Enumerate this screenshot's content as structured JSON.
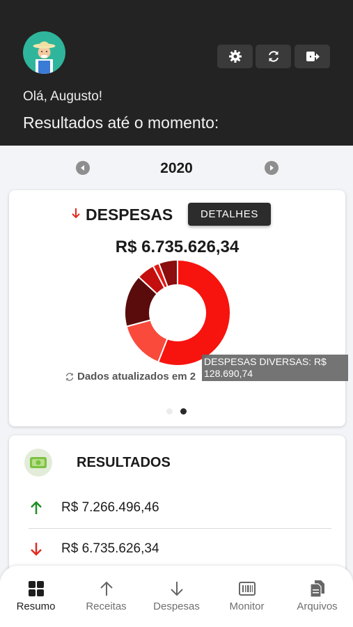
{
  "header": {
    "greeting": "Olá, Augusto!",
    "subtitle": "Resultados até o momento:",
    "buttons": [
      {
        "name": "settings",
        "icon": "gear-icon"
      },
      {
        "name": "refresh",
        "icon": "refresh-icon"
      },
      {
        "name": "logout",
        "icon": "logout-icon"
      }
    ]
  },
  "year_selector": {
    "year": "2020",
    "prev_icon": "chevron-left-icon",
    "next_icon": "chevron-right-icon"
  },
  "expenses_card": {
    "title": "DESPESAS",
    "title_icon": "arrow-down-icon",
    "details_button": "DETALHES",
    "total": "R$ 6.735.626,34",
    "updated_text": "Dados atualizados em 2",
    "tooltip_line1": "DESPESAS DIVERSAS: R$",
    "tooltip_line2": "128.690,74",
    "pagination": {
      "count": 2,
      "active": 1
    }
  },
  "chart_data": {
    "type": "pie",
    "variant": "donut",
    "slices": [
      {
        "value": 3770000,
        "color": "#f7130e"
      },
      {
        "value": 1000000,
        "color": "#f94a3c"
      },
      {
        "value": 1080000,
        "color": "#5a0b0b"
      },
      {
        "value": 370000,
        "color": "#c40f0f"
      },
      {
        "value": 128690.74,
        "color": "#e01a14",
        "name": "DESPESAS DIVERSAS"
      },
      {
        "value": 386935.6,
        "color": "#8b0d0d"
      }
    ]
  },
  "results_card": {
    "title": "RESULTADOS",
    "icon": "money-icon",
    "income": {
      "icon": "arrow-up-icon",
      "value": "R$ 7.266.496,46",
      "color": "#1e8e25"
    },
    "expense": {
      "icon": "arrow-down-icon",
      "value": "R$ 6.735.626,34",
      "color": "#e02a20"
    }
  },
  "bottom_nav": [
    {
      "label": "Resumo",
      "icon": "dashboard-icon",
      "active": true
    },
    {
      "label": "Receitas",
      "icon": "arrow-up-icon",
      "active": false
    },
    {
      "label": "Despesas",
      "icon": "arrow-down-icon",
      "active": false
    },
    {
      "label": "Monitor",
      "icon": "barcode-icon",
      "active": false
    },
    {
      "label": "Arquivos",
      "icon": "files-icon",
      "active": false
    }
  ]
}
